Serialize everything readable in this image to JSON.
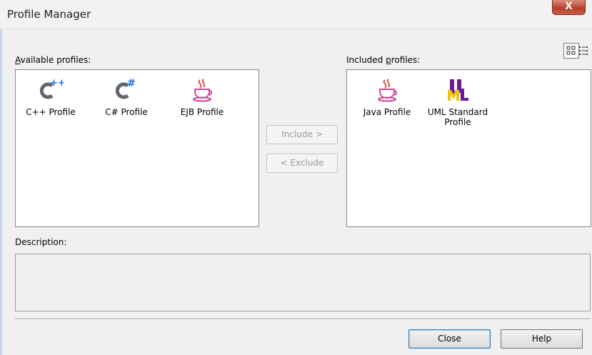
{
  "window": {
    "title": "Profile Manager",
    "close_glyph": "X"
  },
  "available": {
    "label_prefix": "A",
    "label_rest": "vailable profiles:",
    "items": [
      {
        "name": "C++ Profile",
        "icon": "cpp-icon"
      },
      {
        "name": "C# Profile",
        "icon": "csharp-icon"
      },
      {
        "name": "EJB Profile",
        "icon": "java-cup-icon"
      }
    ]
  },
  "included": {
    "label_pre": "Included ",
    "label_mnemonic": "p",
    "label_post": "rofiles:",
    "items": [
      {
        "name": "Java Profile",
        "icon": "java-cup-icon"
      },
      {
        "name_line1": "UML Standard",
        "name_line2": "Profile",
        "icon": "uml-icon"
      }
    ]
  },
  "buttons": {
    "include": "Include >",
    "exclude": "< Exclude",
    "close": "Close",
    "help": "Help"
  },
  "description": {
    "label": "Description:"
  },
  "colors": {
    "accent": "#3c7fb1",
    "cpp_blue": "#1a6fe0",
    "uml_purple": "#6a1b9a",
    "uml_yellow": "#f5c400"
  }
}
